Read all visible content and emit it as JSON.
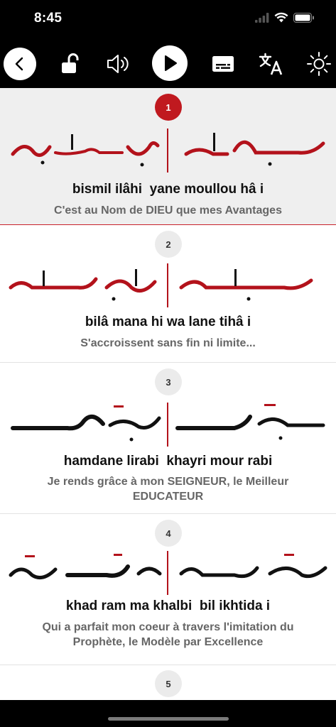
{
  "status": {
    "time": "8:45"
  },
  "toolbar": {
    "icons": [
      "chevron-left-icon",
      "unlock-icon",
      "speaker-icon",
      "play-icon",
      "subtitles-icon",
      "translate-icon",
      "brightness-icon"
    ]
  },
  "colors": {
    "accent": "#c0191f",
    "ink": "#111111",
    "muted": "#666666",
    "active_bg": "#efefef"
  },
  "verses": [
    {
      "number": "1",
      "translit": "bismil ilâhi  yane moullou hâ i",
      "translation": "C'est au Nom de DIEU que mes Avantages"
    },
    {
      "number": "2",
      "translit": "bilâ mana hi wa lane tihâ i",
      "translation": "S'accroissent sans fin ni limite..."
    },
    {
      "number": "3",
      "translit": "hamdane lirabi  khayri mour rabi",
      "translation": "Je rends grâce à mon SEIGNEUR, le Meilleur EDUCATEUR"
    },
    {
      "number": "4",
      "translit": "khad ram ma khalbi  bil ikhtida i",
      "translation": "Qui a parfait mon coeur à travers l'imitation du Prophète, le Modèle par Excellence"
    },
    {
      "number": "5"
    }
  ]
}
